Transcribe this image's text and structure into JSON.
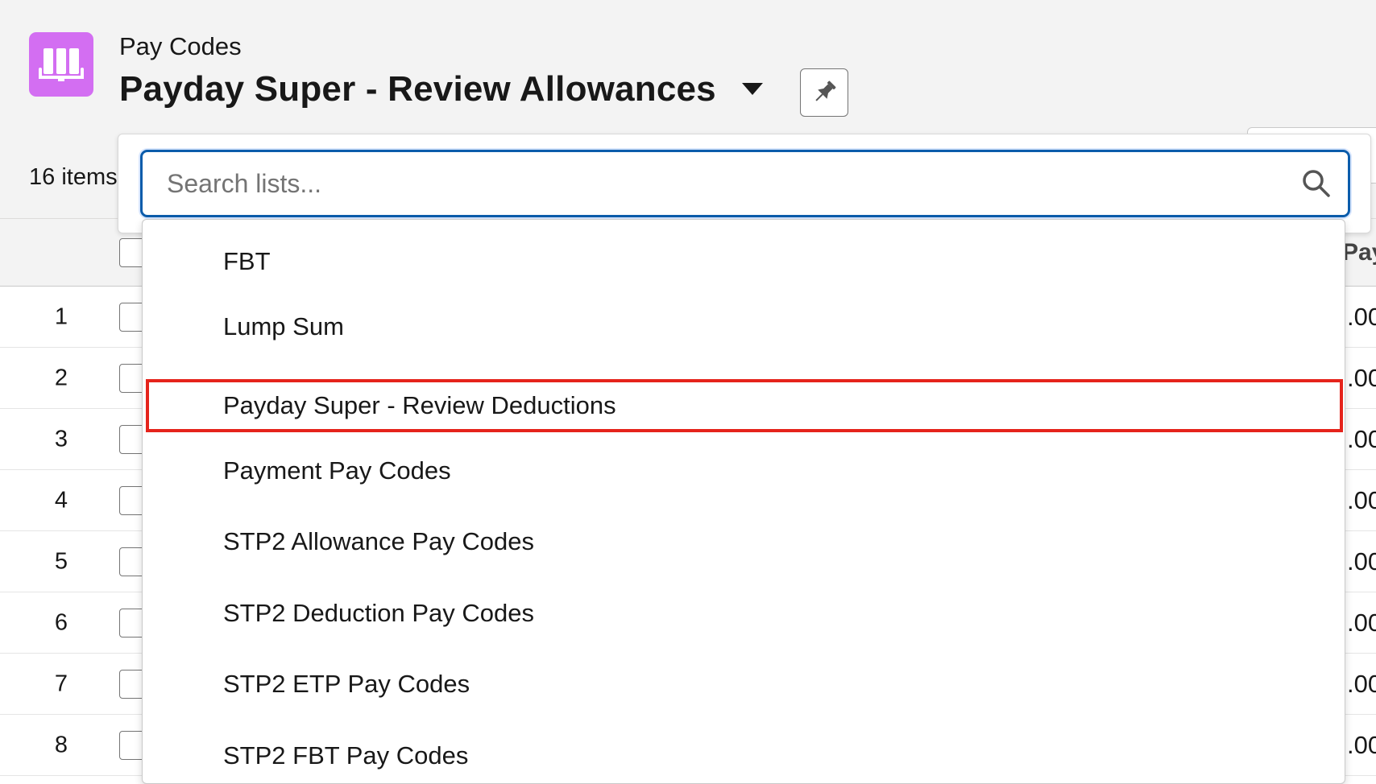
{
  "header": {
    "object_label": "Pay Codes",
    "list_title": "Payday Super - Review Allowances",
    "item_count": "16 items"
  },
  "colors": {
    "app_icon_bg": "#d36ef2",
    "focus_border": "#0b5cab",
    "highlight_border": "#e5231b"
  },
  "search": {
    "placeholder": "Search lists...",
    "value": ""
  },
  "list_menu": {
    "items": [
      {
        "label": "FBT"
      },
      {
        "label": "Lump Sum"
      },
      {
        "label": "Payday Super - Review Deductions",
        "highlighted": true
      },
      {
        "label": "Payment Pay Codes"
      },
      {
        "label": "STP2 Allowance Pay Codes"
      },
      {
        "label": "STP2 Deduction Pay Codes"
      },
      {
        "label": "STP2 ETP Pay Codes"
      },
      {
        "label": "STP2 FBT Pay Codes"
      }
    ]
  },
  "table": {
    "partial_header": "Pay",
    "rows": [
      {
        "num": "1",
        "amount": ".00"
      },
      {
        "num": "2",
        "amount": ".00"
      },
      {
        "num": "3",
        "amount": ".00"
      },
      {
        "num": "4",
        "amount": ".00"
      },
      {
        "num": "5",
        "amount": ".00"
      },
      {
        "num": "6",
        "amount": ".00"
      },
      {
        "num": "7",
        "amount": ".00"
      },
      {
        "num": "8",
        "amount": ".00"
      }
    ]
  }
}
